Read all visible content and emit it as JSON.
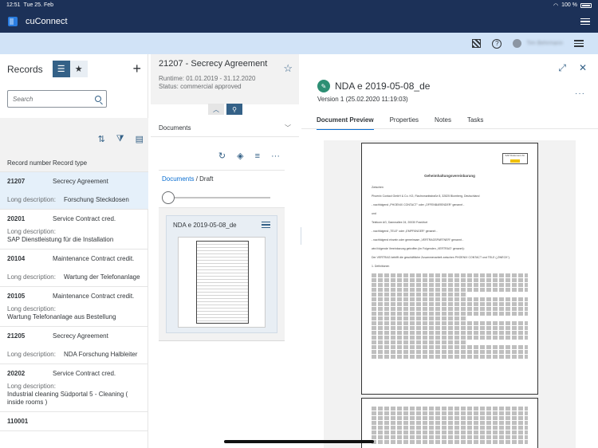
{
  "status": {
    "time": "12:51",
    "date": "Tue 25. Feb",
    "battery": "100 %"
  },
  "app": {
    "title": "cuConnect"
  },
  "user": {
    "name": "Tim Behrmann"
  },
  "records": {
    "title": "Records",
    "search_placeholder": "Search",
    "columns": [
      "Record number",
      "Record type"
    ],
    "desc_label": "Long description:",
    "items": [
      {
        "number": "21207",
        "type": "Secrecy Agreement",
        "desc": "Forschung Steckdosen",
        "inline": true
      },
      {
        "number": "20201",
        "type": "Service Contract cred.",
        "desc": "SAP Dienstleistung für die Installation",
        "inline": false
      },
      {
        "number": "20104",
        "type": "Maintenance Contract credit.",
        "desc": "Wartung der Telefonanlage",
        "inline": true
      },
      {
        "number": "20105",
        "type": "Maintenance Contract credit.",
        "desc": "Wartung Telefonanlage aus Bestellung",
        "inline": false
      },
      {
        "number": "21205",
        "type": "Secrecy Agreement",
        "desc": "NDA Forschung Halbleiter",
        "inline": true
      },
      {
        "number": "20202",
        "type": "Service Contract cred.",
        "desc": "Industrial cleaning Südportal 5 - Cleaning ( inside rooms )",
        "inline": false
      },
      {
        "number": "110001",
        "type": "",
        "desc": "",
        "inline": false
      }
    ]
  },
  "detail": {
    "title": "21207 - Secrecy Agreement",
    "runtime": "Runtime: 01.01.2019 - 31.12.2020",
    "status": "Status: commercial approved",
    "documents_label": "Documents",
    "breadcrumb_root": "Documents",
    "breadcrumb_sep": " / ",
    "breadcrumb_current": "Draft",
    "card_title": "NDA e 2019-05-08_de"
  },
  "viewer": {
    "doc_title": "NDA e 2019-05-08_de",
    "version": "Version 1 (25.02.2020 11:19:03)",
    "tabs": [
      "Document Preview",
      "Properties",
      "Notes",
      "Tasks"
    ],
    "page_title": "Geheimhaltungsvereinbarung",
    "page_lines": [
      "Zwischen",
      "Phoenix Contact GmbH & Co. KG, Flachsmarktstraße 8, 32825 Blomberg, Deutschland",
      "- nachfolgend „PHOENIX CONTACT“ oder „OFFENBARENDER“ genannt -",
      "und",
      "Telekom AG, Dammallee 24, 20030 Frankfurt",
      "- nachfolgend „TELE“ oder „EMPFÄNGER“ genannt -",
      "- nachfolgend einzeln oder gemeinsam „VERTRAGSPARTNER“ genannt -",
      "wird folgende Vereinbarung getroffen (im Folgenden „VERTRAG“ genannt):",
      "Der VERTRAG betrifft die geschäftliche Zusammenarbeit zwischen PHOENIX CONTACT und TELE („ZWECK“).",
      "1. Definitionen"
    ]
  }
}
